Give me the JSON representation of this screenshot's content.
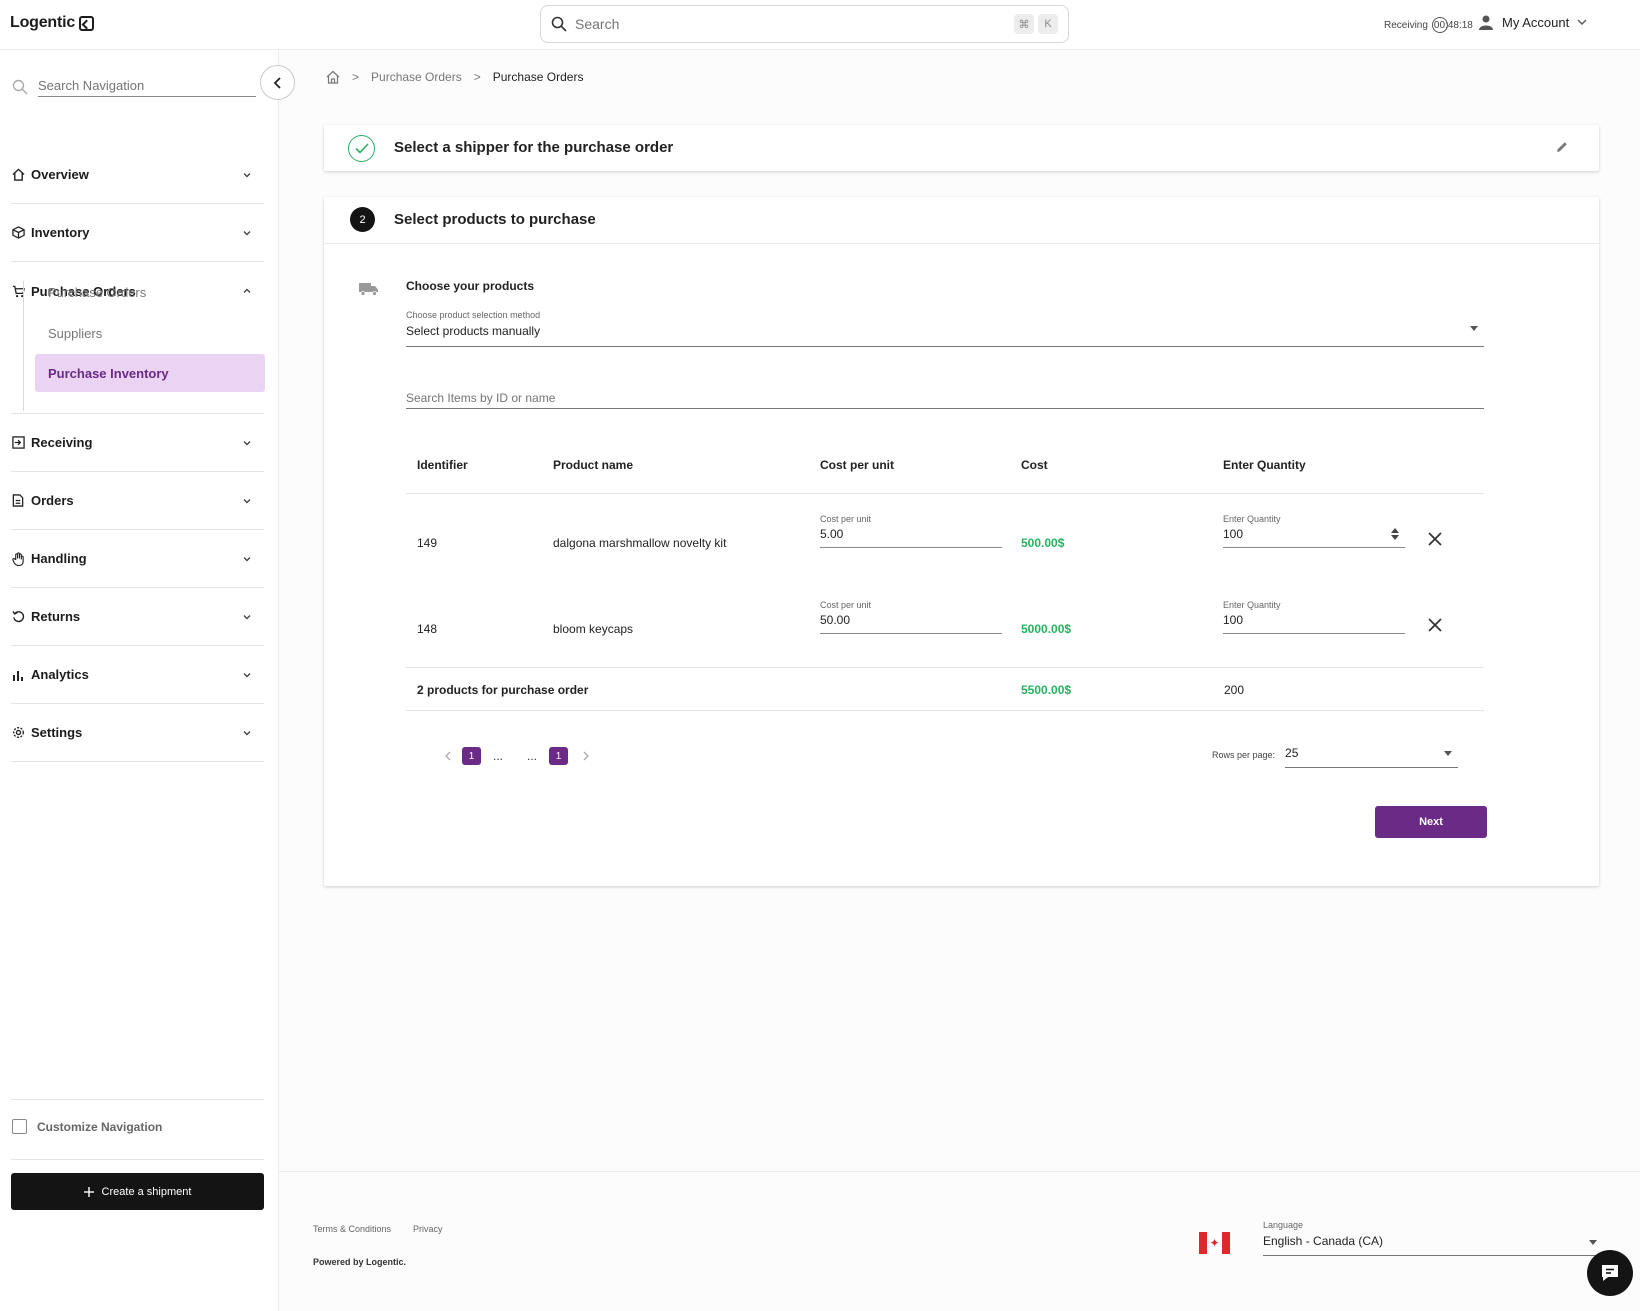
{
  "header": {
    "logo_text": "Logentic",
    "search_placeholder": "Search",
    "shortcut_cmd": "⌘",
    "shortcut_key": "K",
    "receiving_label": "Receiving",
    "receiving_time": "00:48:18",
    "account_label": "My Account"
  },
  "sidebar": {
    "search_placeholder": "Search Navigation",
    "groups": [
      {
        "label": "Overview",
        "icon": "home-icon"
      },
      {
        "label": "Inventory",
        "icon": "box-icon"
      },
      {
        "label": "Purchase Orders",
        "icon": "cart-icon"
      },
      {
        "label": "Receiving",
        "icon": "receiving-icon"
      },
      {
        "label": "Orders",
        "icon": "document-icon"
      },
      {
        "label": "Handling",
        "icon": "hand-icon"
      },
      {
        "label": "Returns",
        "icon": "return-icon"
      },
      {
        "label": "Analytics",
        "icon": "bar-chart-icon"
      },
      {
        "label": "Settings",
        "icon": "gear-icon"
      }
    ],
    "sub_items": [
      "Purchase Orders",
      "Suppliers",
      "Purchase Inventory"
    ],
    "customize_label": "Customize Navigation",
    "create_button": "Create a shipment"
  },
  "breadcrumb": [
    "Purchase Orders",
    "Purchase Orders"
  ],
  "step1": {
    "title": "Select a shipper for the purchase order"
  },
  "step2": {
    "number": "2",
    "title": "Select products to purchase",
    "choose_title": "Choose your products",
    "method_label": "Choose product selection method",
    "method_value": "Select products manually",
    "search_placeholder": "Search Items by ID or name",
    "columns": [
      "Identifier",
      "Product name",
      "Cost per unit",
      "Cost",
      "Enter Quantity"
    ],
    "field_cost_label": "Cost per unit",
    "field_qty_label": "Enter Quantity",
    "rows": [
      {
        "id": "149",
        "name": "dalgona marshmallow novelty kit",
        "cost_per_unit": "5.00",
        "cost": "500.00$",
        "quantity": "100"
      },
      {
        "id": "148",
        "name": "bloom keycaps",
        "cost_per_unit": "50.00",
        "cost": "5000.00$",
        "quantity": "100"
      }
    ],
    "total_label": "2 products for purchase order",
    "total_cost": "5500.00$",
    "total_quantity": "200",
    "pagination": {
      "first": "1",
      "dots": "...",
      "last": "1"
    },
    "rows_per_page_label": "Rows per page:",
    "rows_per_page_value": "25",
    "next_button": "Next"
  },
  "footer": {
    "terms": "Terms & Conditions",
    "privacy": "Privacy",
    "powered": "Powered by Logentic.",
    "language_label": "Language",
    "language_value": "English - Canada (CA)"
  },
  "colors": {
    "accent": "#6a2a86",
    "accent_light": "#ebd3f3",
    "success": "#25b35f",
    "dark": "#141414"
  }
}
